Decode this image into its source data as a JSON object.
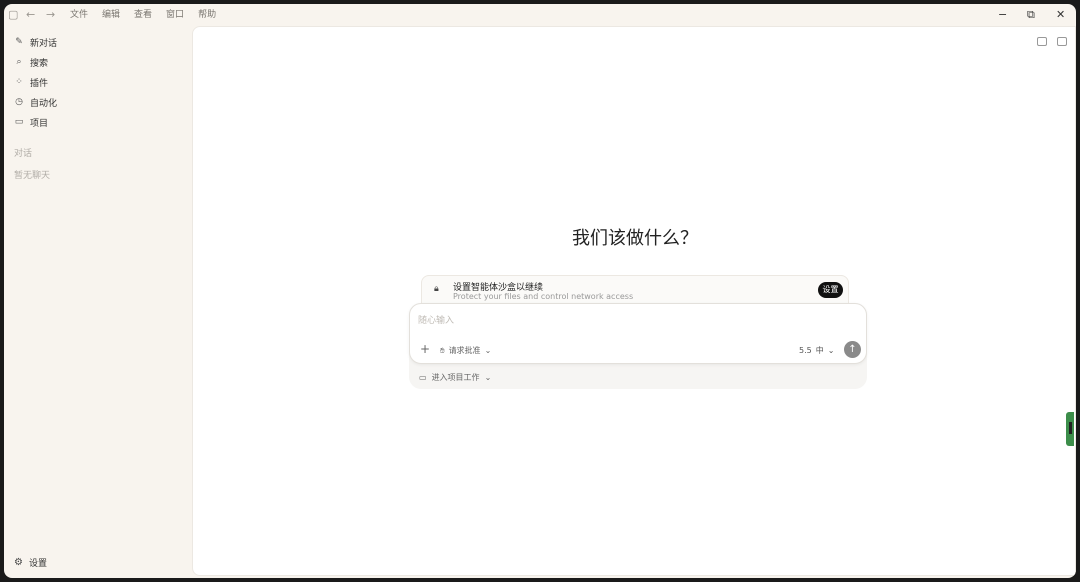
{
  "titlebar": {
    "menu": [
      "文件",
      "编辑",
      "查看",
      "窗口",
      "帮助"
    ],
    "icons": [
      "sidebar-toggle-icon",
      "back-arrow-icon",
      "forward-arrow-icon"
    ],
    "window_controls": [
      "minimize-icon",
      "restore-icon",
      "close-icon"
    ]
  },
  "sidebar": {
    "items": [
      {
        "label": "新对话",
        "icon": "edit-icon"
      },
      {
        "label": "搜索",
        "icon": "search-icon"
      },
      {
        "label": "插件",
        "icon": "grid-icon"
      },
      {
        "label": "自动化",
        "icon": "clock-icon"
      },
      {
        "label": "项目",
        "icon": "folder-icon"
      }
    ],
    "section_label": "对话",
    "empty_text": "暂无聊天",
    "settings_label": "设置"
  },
  "main": {
    "heading": "我们该做什么？",
    "sandbox": {
      "title": "设置智能体沙盒以继续",
      "subtitle": "Protect your files and control network access",
      "button": "设置"
    },
    "input": {
      "placeholder": "随心输入",
      "approval": "请求批准",
      "model": "5.5",
      "effort": "中"
    },
    "project_label": "进入项目工作"
  },
  "colors": {
    "sidebar_bg": "#f8f4ee",
    "main_bg": "#ffffff",
    "send_button": "#8a8a8a",
    "edge_handle": "#3c8d4a"
  }
}
